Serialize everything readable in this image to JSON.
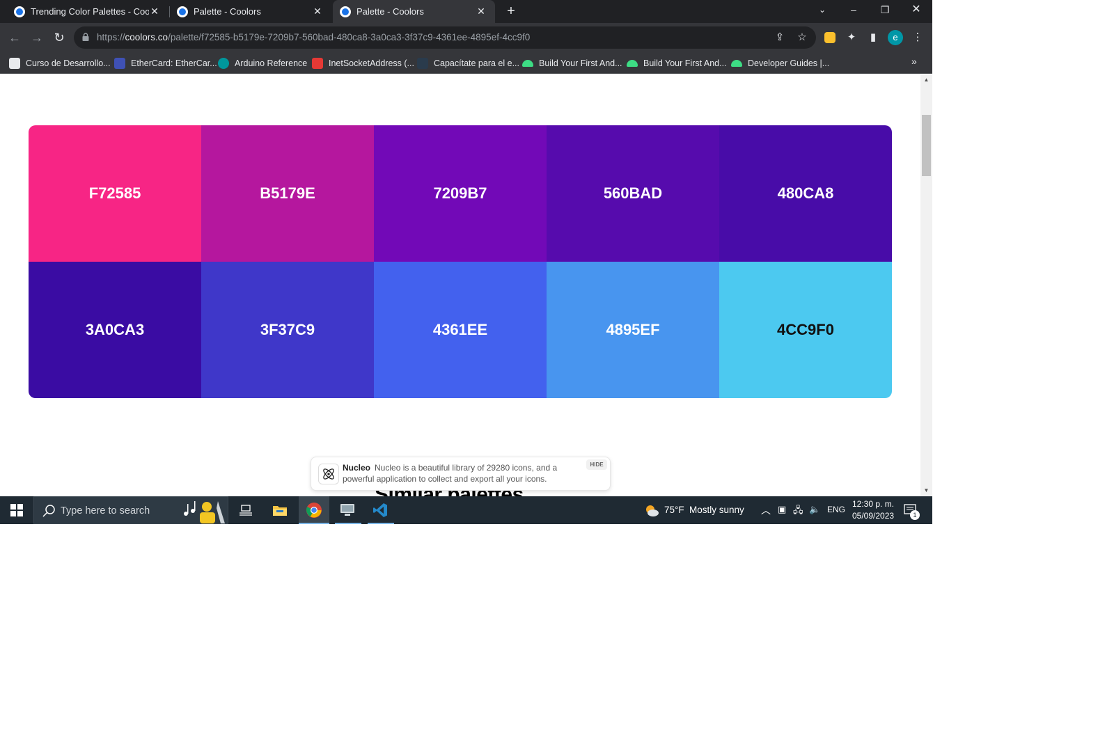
{
  "browser": {
    "tabs": [
      {
        "title": "Trending Color Palettes - Coolors"
      },
      {
        "title": "Palette - Coolors"
      },
      {
        "title": "Palette - Coolors"
      }
    ],
    "url_scheme": "https://",
    "url_host": "coolors.co",
    "url_path": "/palette/f72585-b5179e-7209b7-560bad-480ca8-3a0ca3-3f37c9-4361ee-4895ef-4cc9f0",
    "profile_initial": "e",
    "bookmarks": [
      {
        "label": "Curso de Desarrollo...",
        "color": "#e8eaed"
      },
      {
        "label": "EtherCard: EtherCar...",
        "color": "#3f51b5"
      },
      {
        "label": "Arduino Reference",
        "color": "#00979c"
      },
      {
        "label": "InetSocketAddress (...",
        "color": "#e53935"
      },
      {
        "label": "Capacítate para el e...",
        "color": "#2a3b4c"
      },
      {
        "label": "Build Your First And...",
        "color": "#3ddc84"
      },
      {
        "label": "Build Your First And...",
        "color": "#3ddc84"
      },
      {
        "label": "Developer Guides  |...",
        "color": "#3ddc84"
      }
    ],
    "bookmarks_overflow": "»"
  },
  "palette": {
    "swatches": [
      {
        "hex": "F72585",
        "color": "#f72585",
        "text_color": "#ffffff"
      },
      {
        "hex": "B5179E",
        "color": "#b5179e",
        "text_color": "#ffffff"
      },
      {
        "hex": "7209B7",
        "color": "#7209b7",
        "text_color": "#ffffff"
      },
      {
        "hex": "560BAD",
        "color": "#560bad",
        "text_color": "#ffffff"
      },
      {
        "hex": "480CA8",
        "color": "#480ca8",
        "text_color": "#ffffff"
      },
      {
        "hex": "3A0CA3",
        "color": "#3a0ca3",
        "text_color": "#ffffff"
      },
      {
        "hex": "3F37C9",
        "color": "#3f37c9",
        "text_color": "#ffffff"
      },
      {
        "hex": "4361EE",
        "color": "#4361ee",
        "text_color": "#ffffff"
      },
      {
        "hex": "4895EF",
        "color": "#4895ef",
        "text_color": "#ffffff"
      },
      {
        "hex": "4CC9F0",
        "color": "#4cc9f0",
        "text_color": "#111111"
      }
    ]
  },
  "page": {
    "similar_heading": "Similar palettes"
  },
  "ad": {
    "brand": "Nucleo",
    "text": "Nucleo is a beautiful library of 29280 icons, and a powerful application to collect and export all your icons.",
    "hide_label": "HIDE"
  },
  "taskbar": {
    "search_placeholder": "Type here to search",
    "weather_temp": "75°F",
    "weather_desc": "Mostly sunny",
    "language": "ENG",
    "time": "12:30 p. m.",
    "date": "05/09/2023",
    "notification_count": "1"
  }
}
